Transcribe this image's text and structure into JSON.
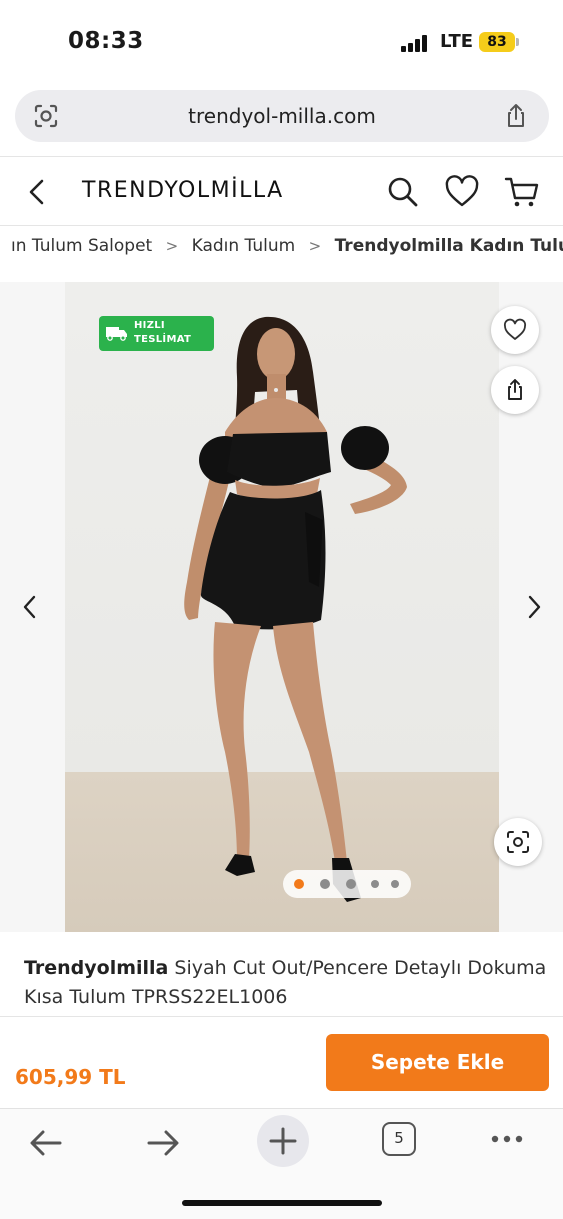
{
  "status_bar": {
    "time": "08:33",
    "network": "LTE",
    "battery": "83"
  },
  "url_bar": {
    "url": "trendyol-milla.com",
    "left_icon": "visual-search-icon",
    "right_icon": "share-icon"
  },
  "header": {
    "brand": "TRENDYOLMİLLA",
    "icons": [
      "back-chevron-icon",
      "search-icon",
      "heart-icon",
      "cart-icon"
    ]
  },
  "breadcrumb": {
    "items": [
      "ın Tulum Salopet",
      "Kadın Tulum",
      "Trendyolmilla Kadın Tulum"
    ],
    "separator": ">"
  },
  "gallery": {
    "badge_line1": "HIZLI",
    "badge_line2": "TESLİMAT",
    "badge_color": "#2bb24c",
    "image_count": 5,
    "active_image": 1,
    "product_image": "model wearing black off-shoulder cut-out mini jumpsuit"
  },
  "product": {
    "brand": "Trendyolmilla",
    "name": "Siyah Cut Out/Pencere Detaylı Dokuma Kısa Tulum TPRSS22EL1006"
  },
  "purchase": {
    "price": "605,99 TL",
    "add_to_cart": "Sepete Ekle",
    "accent_color": "#f27a1a"
  },
  "browser_toolbar": {
    "tab_count": "5",
    "icons": [
      "back-arrow-icon",
      "forward-arrow-icon",
      "new-tab-plus-icon",
      "tabs-icon",
      "more-icon"
    ]
  }
}
